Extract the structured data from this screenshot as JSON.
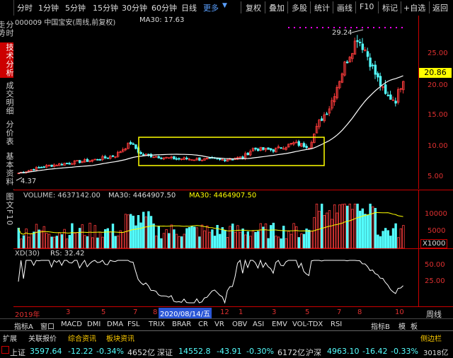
{
  "toolbar": {
    "periods": [
      "分时",
      "1分钟",
      "5分钟",
      "15分钟",
      "30分钟",
      "60分钟",
      "日线",
      "更多"
    ],
    "buttons": [
      "复权",
      "叠加",
      "多股",
      "统计",
      "画线",
      "F10",
      "标记",
      "+自选",
      "返回"
    ]
  },
  "left_tabs": [
    "分时走势",
    "技术分析",
    "成交明细",
    "分价表",
    "基本资料",
    "图文F10"
  ],
  "active_left_tab": "技术分析",
  "main": {
    "title": "000009 中国宝安(周线,前复权)",
    "ma_label": "MA30: 17.63",
    "high_label": "29.24",
    "low_label": "4.37",
    "current_price": "20.86",
    "y_ticks": [
      "25.00",
      "20.00",
      "15.00",
      "10.00",
      "5.00"
    ]
  },
  "volume": {
    "label": "VOLUME: 4637142.00",
    "ma30_white": "MA30: 4464907.50",
    "ma30_yellow": "MA30: 4464907.50",
    "y_ticks": [
      "10000",
      "5000",
      "X1000"
    ]
  },
  "xd": {
    "label": "XD(30)",
    "rs": "RS: 32.42",
    "y_ticks": [
      "50.00",
      "25.00"
    ]
  },
  "x_axis": {
    "labels": [
      "2019年",
      "3",
      "5",
      "7",
      "8",
      "2020/08/14/五",
      "12",
      "1",
      "3",
      "5",
      "7",
      "8",
      "10"
    ],
    "period": "周线"
  },
  "bottom_tabs": {
    "indicators": [
      "指标A",
      "窗口",
      "MACD",
      "DMI",
      "DMA",
      "FSL",
      "TRIX",
      "BRAR",
      "CR",
      "VR",
      "OBV",
      "ASI",
      "EMV",
      "VOL-TDX",
      "RSI"
    ],
    "right": [
      "指标B",
      "模",
      "板"
    ],
    "row2": [
      "扩展",
      "关联报价",
      "综合资讯",
      "板块资讯"
    ],
    "side_right": "侧边栏"
  },
  "status": {
    "items": [
      {
        "name": "上证",
        "price": "3597.64",
        "chg": "-12.22",
        "pct": "-0.34%",
        "amt": "4652亿"
      },
      {
        "name": "深证",
        "price": "14552.8",
        "chg": "-43.91",
        "pct": "-0.30%",
        "amt": "6172亿"
      },
      {
        "name": "沪深",
        "price": "4963.10",
        "chg": "-16.42",
        "pct": "-0.33%",
        "amt": "3018亿"
      }
    ]
  },
  "colors": {
    "up": "#ff3c3c",
    "down": "#54ffff",
    "ma": "#ffffff",
    "yellow": "#ffff00",
    "magenta": "#ff00ff"
  }
}
